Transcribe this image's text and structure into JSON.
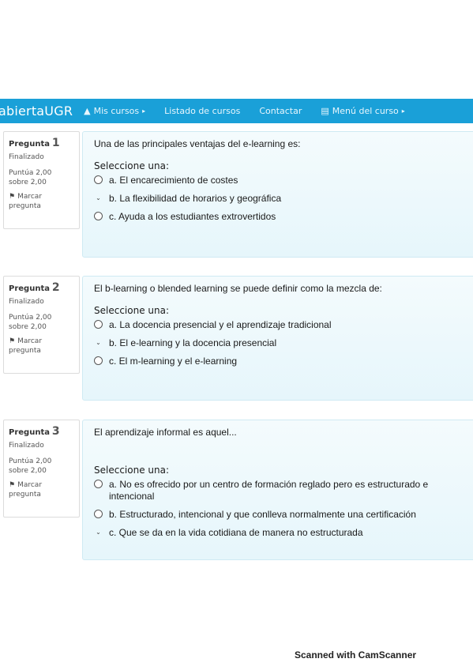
{
  "navbar": {
    "brand": "abiertaUGR",
    "items": [
      {
        "icon": "mortarboard-icon",
        "glyph": "▲",
        "label": "Mis cursos",
        "caret": "▸"
      },
      {
        "label": "Listado de cursos"
      },
      {
        "label": "Contactar"
      },
      {
        "icon": "book-icon",
        "glyph": "▤",
        "label": "Menú del curso",
        "caret": "▸"
      }
    ]
  },
  "questions": [
    {
      "title": "Pregunta",
      "number": "1",
      "status": "Finalizado",
      "score_line1": "Puntúa 2,00",
      "score_line2": "sobre 2,00",
      "flag_line1": "Marcar",
      "flag_line2": "pregunta",
      "text": "Una de las principales ventajas del e-learning es:",
      "prompt": "Seleccione una:",
      "answers": [
        {
          "text": "a. El encarecimiento de costes",
          "selected": false
        },
        {
          "text": "b. La flexibilidad de horarios y geográfica",
          "selected": true
        },
        {
          "text": "c. Ayuda a los estudiantes extrovertidos",
          "selected": false
        }
      ]
    },
    {
      "title": "Pregunta",
      "number": "2",
      "status": "Finalizado",
      "score_line1": "Puntúa 2,00",
      "score_line2": "sobre 2,00",
      "flag_line1": "Marcar",
      "flag_line2": "pregunta",
      "text": "El b-learning o blended learning se puede definir como la mezcla de:",
      "prompt": "Seleccione una:",
      "answers": [
        {
          "text": "a. La docencia presencial y el aprendizaje tradicional",
          "selected": false
        },
        {
          "text": "b. El e-learning y la docencia presencial",
          "selected": true
        },
        {
          "text": "c. El m-learning y el e-learning",
          "selected": false
        }
      ]
    },
    {
      "title": "Pregunta",
      "number": "3",
      "status": "Finalizado",
      "score_line1": "Puntúa 2,00",
      "score_line2": "sobre 2,00",
      "flag_line1": "Marcar",
      "flag_line2": "pregunta",
      "text": "El aprendizaje informal es aquel...",
      "prompt": "Seleccione una:",
      "answers": [
        {
          "text": "a. No es ofrecido por un centro de formación reglado pero es estructurado e intencional",
          "selected": false
        },
        {
          "text": "b. Estructurado, intencional y que conlleva normalmente una certificación",
          "selected": false
        },
        {
          "text": "c. Que se da en la vida cotidiana de manera no estructurada",
          "selected": true
        }
      ]
    }
  ],
  "footer": "Scanned with CamScanner",
  "colors": {
    "navbar": "#1aa0d8",
    "content_bg": "#e6f6fb"
  }
}
